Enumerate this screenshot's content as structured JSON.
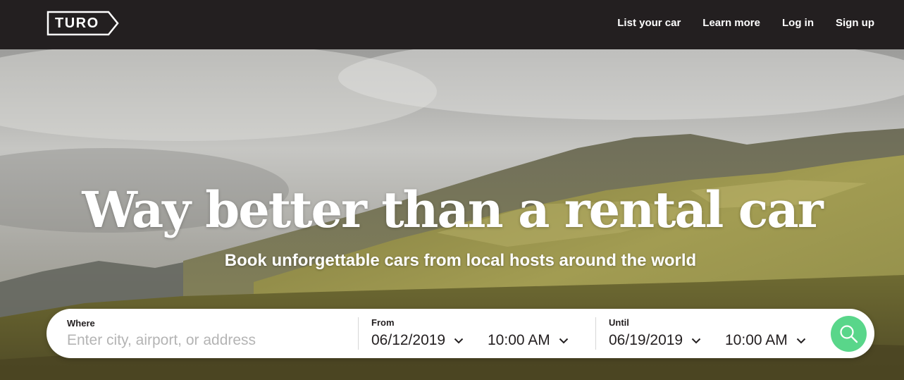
{
  "brand": {
    "logo_text": "TURO"
  },
  "nav": {
    "items": [
      {
        "label": "List your car"
      },
      {
        "label": "Learn more"
      },
      {
        "label": "Log in"
      },
      {
        "label": "Sign up"
      }
    ]
  },
  "hero": {
    "headline": "Way better than a rental car",
    "subheadline": "Book unforgettable cars from local hosts around the world"
  },
  "search": {
    "where": {
      "label": "Where",
      "placeholder": "Enter city, airport, or address",
      "value": ""
    },
    "from": {
      "label": "From",
      "date": "06/12/2019",
      "time": "10:00 AM"
    },
    "until": {
      "label": "Until",
      "date": "06/19/2019",
      "time": "10:00 AM"
    },
    "button_icon": "search-icon",
    "accent_color": "#59d68a"
  },
  "colors": {
    "topbar": "#231f20",
    "search_button": "#59d68a"
  }
}
